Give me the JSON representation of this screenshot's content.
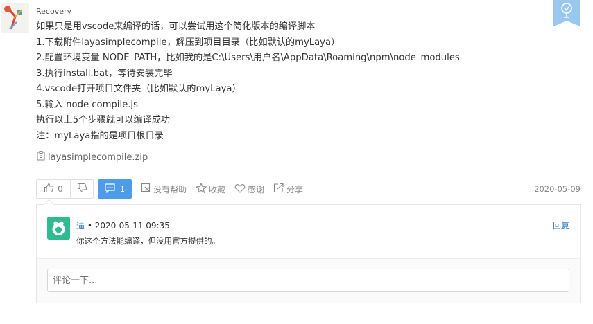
{
  "post": {
    "username": "Recovery",
    "lines": [
      "如果只是用vscode来编译的话，可以尝试用这个简化版本的编译脚本",
      "1.下载附件layasimplecompile，解压到项目目录（比如默认的myLaya）",
      "2.配置环境变量 NODE_PATH，比如我的是C:\\Users\\用户名\\AppData\\Roaming\\npm\\node_modules",
      "3.执行install.bat，等待安装完毕",
      "4.vscode打开项目文件夹（比如默认的myLaya）",
      "5.输入 node compile.js",
      "执行以上5个步骤就可以编译成功",
      "注：myLaya指的是项目根目录"
    ],
    "attachment": "layasimplecompile.zip",
    "date": "2020-05-09"
  },
  "actions": {
    "like_count": "0",
    "comment_count": "1",
    "unhelpful": "没有帮助",
    "favorite": "收藏",
    "thanks": "感谢",
    "share": "分享"
  },
  "reply": {
    "author": "逼",
    "separator": " • ",
    "datetime": "2020-05-11 09:35",
    "text": "你这个方法能编译，但没用官方提供的。",
    "reply_label": "回复"
  },
  "comment_box": {
    "placeholder": "评论一下..."
  },
  "colors": {
    "accent": "#4d9ce9",
    "link": "#3d7fcf",
    "reply_avatar": "#2fba8f",
    "badge": "#9ac7ee"
  }
}
